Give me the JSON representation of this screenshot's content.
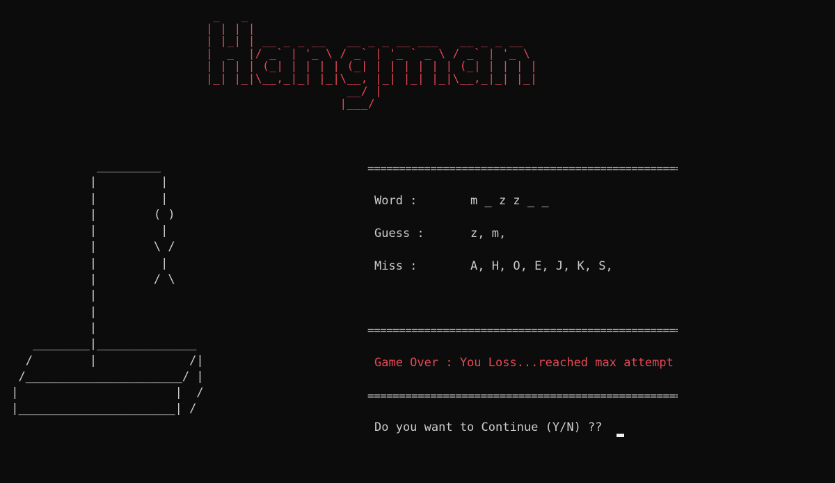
{
  "title_art": " _   _\n| | | |\n| |_| | __ _ _ __   __ _ _ __ ___   __ _ _ __\n|  _  |/ _` | '_ \\ / _` | '_ ` _ \\ / _` | '_ \\\n| | | | (_| | | | | (_| | | | | | | (_| | | | |\n|_| |_|\\__,_|_| |_|\\__, |_| |_| |_|\\__,_|_| |_|\n                    __/ |\n                   |___/",
  "gallows_art": "             _________\n            |         |\n            |         |\n            |        ( )\n            |         |\n            |        \\ /\n            |         |\n            |        / \\\n            |\n            |\n            |\n    ________|______________\n   /        |             /|\n  /______________________/ |\n |                      |  /\n |______________________| /",
  "separator": "================================================================",
  "word": {
    "label": "Word :",
    "value": "m _ z z _ _"
  },
  "guess": {
    "label": "Guess :",
    "value": "z, m,"
  },
  "miss": {
    "label": "Miss :",
    "value": "A, H, O, E, J, K, S,"
  },
  "game_over_message": "Game Over : You Loss...reached max attempt",
  "continue_prompt": "Do you want to Continue (Y/N) ??",
  "colors": {
    "background": "#0c0c0c",
    "text": "#cccccc",
    "accent_red": "#e74856"
  }
}
